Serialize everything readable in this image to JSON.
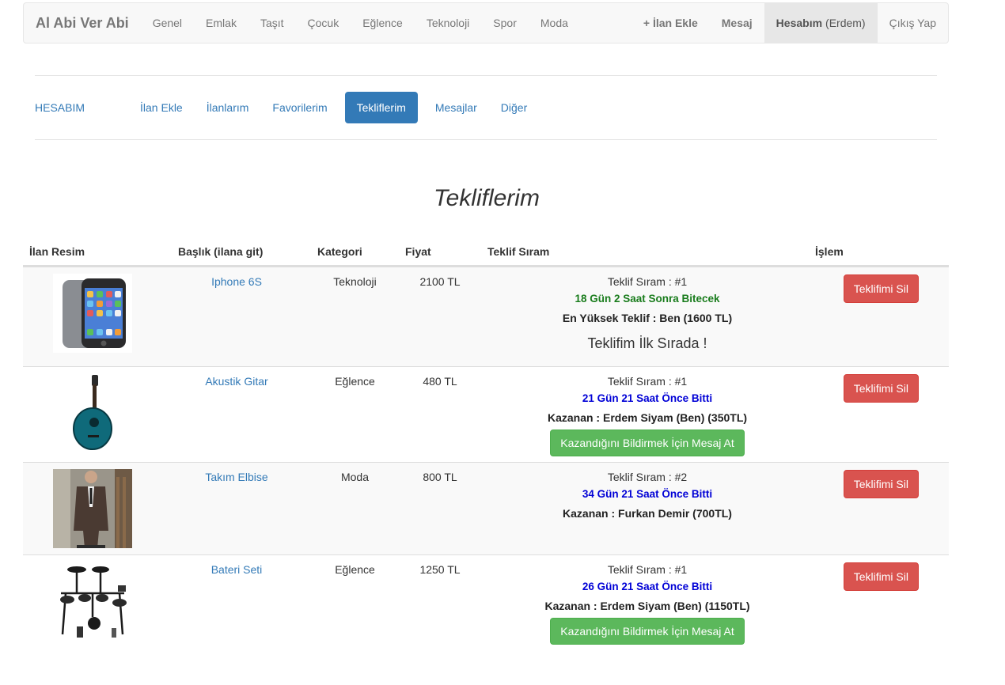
{
  "navbar": {
    "brand": "Al Abi Ver Abi",
    "categories": [
      "Genel",
      "Emlak",
      "Taşıt",
      "Çocuk",
      "Eğlence",
      "Teknoloji",
      "Spor",
      "Moda"
    ],
    "add_listing": "+ İlan Ekle",
    "messages": "Mesaj",
    "account": "Hesabım",
    "account_user": "(Erdem)",
    "logout": "Çıkış Yap"
  },
  "tabs": {
    "account": "HESABIM",
    "items": [
      "İlan Ekle",
      "İlanlarım",
      "Favorilerim",
      "Tekliflerim",
      "Mesajlar",
      "Diğer"
    ],
    "active": "Tekliflerim"
  },
  "page_title": "Tekliflerim",
  "table": {
    "headers": [
      "İlan Resim",
      "Başlık (ilana git)",
      "Kategori",
      "Fiyat",
      "Teklif Sıram",
      "İşlem"
    ],
    "rows": [
      {
        "image_icon": "iphone-image",
        "title": "Iphone 6S",
        "category": "Teknoloji",
        "price": "2100 TL",
        "rank": "Teklif Sıram : #1",
        "time": "18 Gün 2 Saat Sonra Bitecek",
        "line": "En Yüksek Teklif : Ben (1600 TL)",
        "note": "Teklifim İlk Sırada !",
        "delete": "Teklifimi Sil"
      },
      {
        "image_icon": "guitar-image",
        "title": "Akustik Gitar",
        "category": "Eğlence",
        "price": "480 TL",
        "rank": "Teklif Sıram : #1",
        "time": "21 Gün 21 Saat Önce Bitti",
        "line": "Kazanan : Erdem Siyam (Ben) (350TL)",
        "action": "Kazandığını Bildirmek İçin Mesaj At",
        "delete": "Teklifimi Sil"
      },
      {
        "image_icon": "suit-image",
        "title": "Takım Elbise",
        "category": "Moda",
        "price": "800 TL",
        "rank": "Teklif Sıram : #2",
        "time": "34 Gün 21 Saat Önce Bitti",
        "line": "Kazanan : Furkan Demir (700TL)",
        "delete": "Teklifimi Sil"
      },
      {
        "image_icon": "drum-kit-image",
        "title": "Bateri Seti",
        "category": "Eğlence",
        "price": "1250 TL",
        "rank": "Teklif Sıram : #1",
        "time": "26 Gün 21 Saat Önce Bitti",
        "line": "Kazanan : Erdem Siyam (Ben) (1150TL)",
        "action": "Kazandığını Bildirmek İçin Mesaj At",
        "delete": "Teklifimi Sil"
      }
    ]
  },
  "colors": {
    "primary": "#337ab7",
    "danger": "#d9534f",
    "success": "#5cb85c",
    "time_running": "#197c1c",
    "time_ended": "#0000d6"
  }
}
